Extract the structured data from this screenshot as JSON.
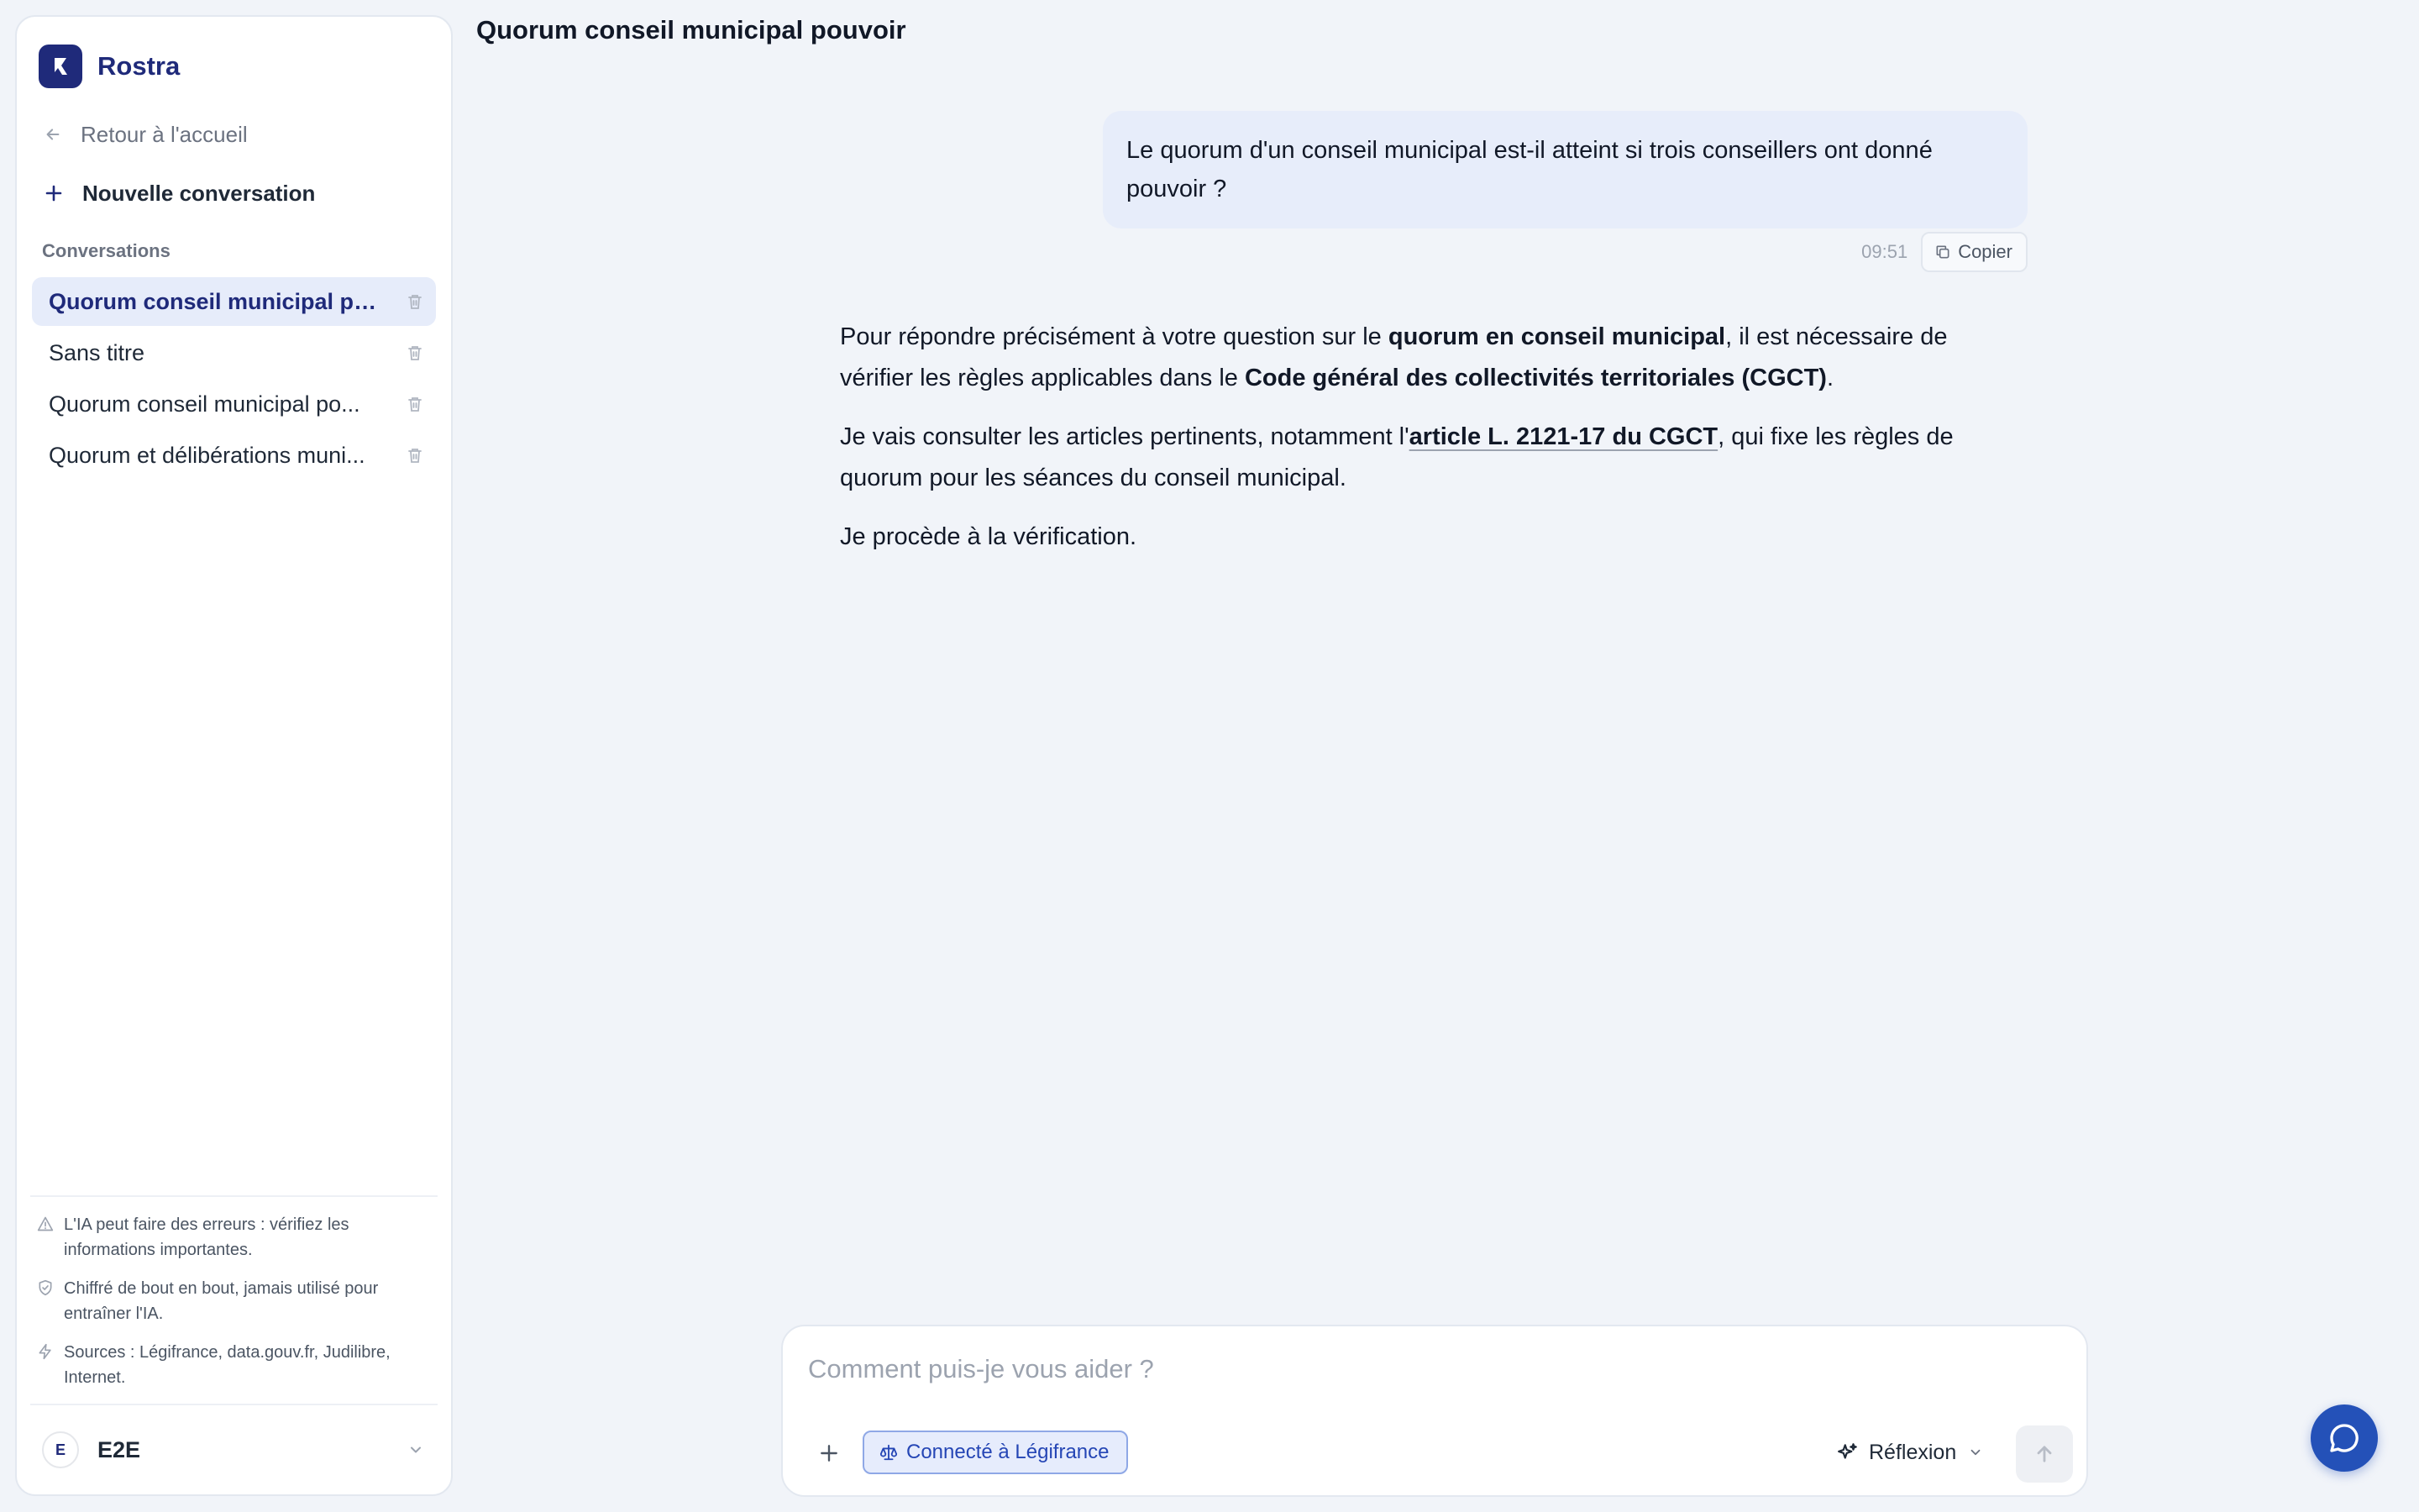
{
  "brand": {
    "name": "Rostra",
    "accent": "#1f2a7a"
  },
  "sidebar": {
    "back_label": "Retour à l'accueil",
    "new_label": "Nouvelle conversation",
    "section_title": "Conversations",
    "conversations": [
      {
        "title": "Quorum conseil municipal po...",
        "active": true
      },
      {
        "title": "Sans titre",
        "active": false
      },
      {
        "title": "Quorum conseil municipal po...",
        "active": false
      },
      {
        "title": "Quorum et délibérations muni...",
        "active": false
      }
    ],
    "notices": [
      {
        "icon": "warning-icon",
        "text": "L'IA peut faire des erreurs : vérifiez les informations importantes."
      },
      {
        "icon": "shield-icon",
        "text": "Chiffré de bout en bout, jamais utilisé pour entraîner l'IA."
      },
      {
        "icon": "bolt-icon",
        "text": "Sources : Légifrance, data.gouv.fr, Judilibre, Internet."
      }
    ],
    "account": {
      "initial": "E",
      "name": "E2E"
    }
  },
  "main": {
    "title": "Quorum conseil municipal pouvoir",
    "user_message": {
      "text": "Le quorum d'un conseil municipal est-il atteint si trois conseillers ont donné pouvoir ?",
      "time": "09:51",
      "copy_label": "Copier"
    },
    "assistant": {
      "p1_a": "Pour répondre précisément à votre question sur le ",
      "p1_b": "quorum en conseil municipal",
      "p1_c": ", il est nécessaire de vérifier les règles applicables dans le ",
      "p1_d": "Code général des collectivités territoriales (CGCT)",
      "p1_e": ".",
      "p2_a": "Je vais consulter les articles pertinents, notamment l'",
      "p2_b": "article L. 2121-17 du CGCT",
      "p2_c": ", qui fixe les règles de quorum pour les séances du conseil municipal.",
      "p3": "Je procède à la vérification."
    }
  },
  "composer": {
    "placeholder": "Comment puis-je vous aider ?",
    "value": "",
    "legifrance_label": "Connecté à Légifrance",
    "mode_label": "Réflexion"
  },
  "colors": {
    "background": "#f1f4f9",
    "user_bubble": "#e7edfa",
    "chip_bg": "#e6ecfc",
    "chip_text": "#2546b5",
    "fab": "#2451b8"
  }
}
